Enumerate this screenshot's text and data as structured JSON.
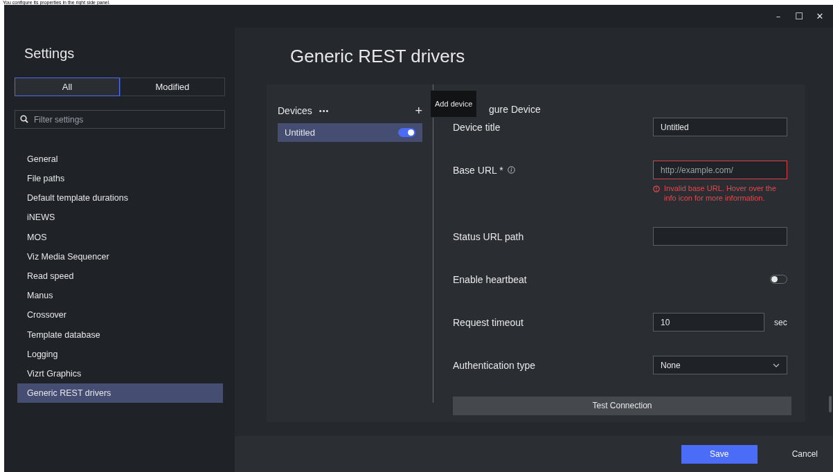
{
  "caption": "You configure its properties in the right side panel.",
  "window": {
    "controls": [
      "–",
      "☐",
      "✕"
    ]
  },
  "sidebar": {
    "title": "Settings",
    "tabs": [
      {
        "label": "All",
        "selected": true
      },
      {
        "label": "Modified",
        "selected": false
      }
    ],
    "search": {
      "placeholder": "Filter settings"
    },
    "items": [
      {
        "label": "General",
        "selected": false
      },
      {
        "label": "File paths",
        "selected": false
      },
      {
        "label": "Default template durations",
        "selected": false
      },
      {
        "label": "iNEWS",
        "selected": false
      },
      {
        "label": "MOS",
        "selected": false
      },
      {
        "label": "Viz Media Sequencer",
        "selected": false
      },
      {
        "label": "Read speed",
        "selected": false
      },
      {
        "label": "Manus",
        "selected": false
      },
      {
        "label": "Crossover",
        "selected": false
      },
      {
        "label": "Template database",
        "selected": false
      },
      {
        "label": "Logging",
        "selected": false
      },
      {
        "label": "Vizrt Graphics",
        "selected": false
      },
      {
        "label": "Generic REST drivers",
        "selected": true
      }
    ]
  },
  "page": {
    "title": "Generic REST drivers",
    "devices": {
      "title": "Devices",
      "more": "•••",
      "add": "+",
      "tooltip": "Add device",
      "items": [
        {
          "label": "Untitled",
          "selected": true,
          "on": true
        }
      ]
    },
    "form": {
      "title": "gure Device",
      "rows": [
        {
          "kind": "text",
          "label": "Device title",
          "value": "Untitled"
        },
        {
          "kind": "text",
          "label": "Base URL *",
          "info": true,
          "placeholder": "http://example.com/",
          "error": "Invalid base URL. Hover over the info icon for more information."
        },
        {
          "kind": "text",
          "label": "Status URL path"
        },
        {
          "kind": "toggle",
          "label": "Enable heartbeat",
          "on": false
        },
        {
          "kind": "number",
          "label": "Request timeout",
          "value": "10",
          "unit": "sec"
        },
        {
          "kind": "select",
          "label": "Authentication type",
          "value": "None"
        }
      ],
      "test_button": "Test Connection"
    }
  },
  "footer": {
    "save": "Save",
    "cancel": "Cancel"
  }
}
